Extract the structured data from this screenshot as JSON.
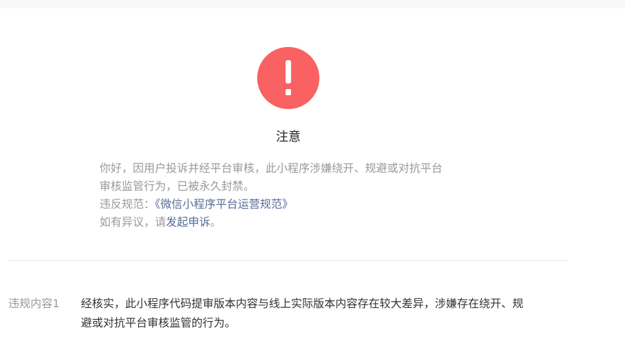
{
  "notice": {
    "title": "注意",
    "icon": "exclamation-icon",
    "icon_color": "#fa6163"
  },
  "message": {
    "line1": "你好，因用户投诉并经平台审核，此小程序涉嫌绕开、规避或对抗平台",
    "line2": "审核监管行为，已被永久封禁。",
    "rule_prefix": "违反规范：",
    "rule_link": "《微信小程序平台运营规范》",
    "appeal_prefix": "如有异议，请",
    "appeal_link": "发起申诉",
    "appeal_suffix": "。"
  },
  "violation": {
    "label": "违规内容1",
    "content_line1": "经核实，此小程序代码提审版本内容与线上实际版本内容存在较大差异，涉嫌存在绕开、规",
    "content_line2": "避或对抗平台审核监管的行为。"
  },
  "colors": {
    "link": "#576b95",
    "muted_text": "#999999",
    "body_text": "#333333"
  }
}
